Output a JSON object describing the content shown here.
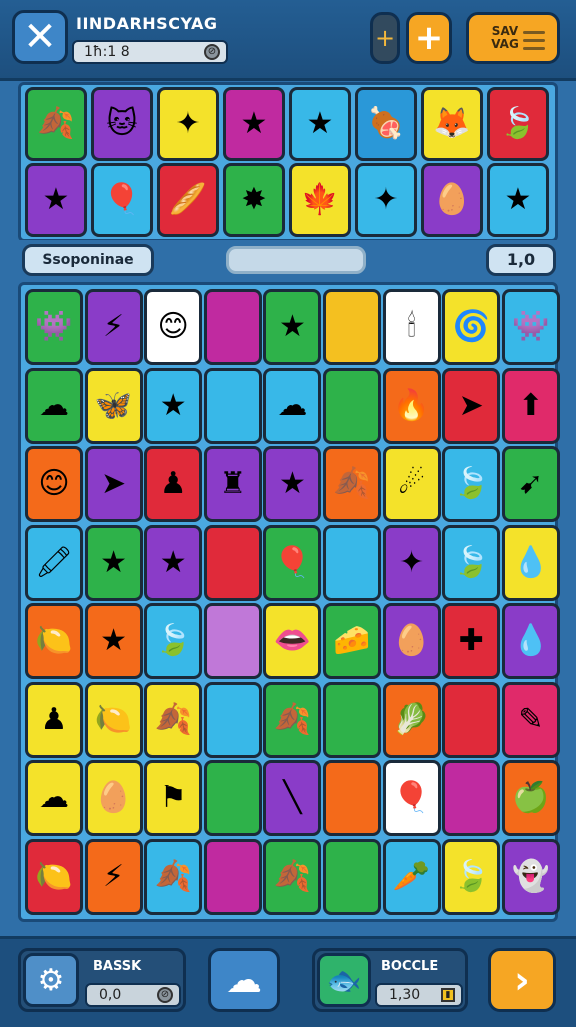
{
  "top_bar": {
    "close_glyph": "✕",
    "title": "IINDARHSCYAG",
    "counter": "1ħ:1 8",
    "counter_icon": "coin-icon",
    "toggle_glyph": "+",
    "plus_glyph": "+",
    "save_label": "SAV VAG"
  },
  "tray_tiles": [
    {
      "color": "#2eb24a",
      "glyph": "🍂",
      "icon": "leaf-icon"
    },
    {
      "color": "#8a3cc8",
      "glyph": "🐱",
      "icon": "cat-icon"
    },
    {
      "color": "#f4e22a",
      "glyph": "✦",
      "icon": "star-shard-icon"
    },
    {
      "color": "#c02aa0",
      "glyph": "★",
      "icon": "star-icon"
    },
    {
      "color": "#38b8e8",
      "glyph": "★",
      "icon": "star-icon"
    },
    {
      "color": "#2a98d8",
      "glyph": "🍖",
      "icon": "meat-icon"
    },
    {
      "color": "#f4e22a",
      "glyph": "🦊",
      "icon": "fox-icon"
    },
    {
      "color": "#e02a3a",
      "glyph": "🍃",
      "icon": "leaf-icon"
    },
    {
      "color": "#8a3cc8",
      "glyph": "★",
      "icon": "star-icon"
    },
    {
      "color": "#38b8e8",
      "glyph": "🎈",
      "icon": "balloon-icon"
    },
    {
      "color": "#e02a3a",
      "glyph": "🥖",
      "icon": "bread-icon"
    },
    {
      "color": "#2eb24a",
      "glyph": "✸",
      "icon": "splat-icon"
    },
    {
      "color": "#f4e22a",
      "glyph": "🍁",
      "icon": "leaf-icon"
    },
    {
      "color": "#38b8e8",
      "glyph": "✦",
      "icon": "star-icon"
    },
    {
      "color": "#8a3cc8",
      "glyph": "🥚",
      "icon": "egg-icon"
    },
    {
      "color": "#38b8e8",
      "glyph": "★",
      "icon": "star-icon"
    }
  ],
  "status_row": {
    "left_label": "Ssoponinae",
    "right_value": "1,0"
  },
  "board_rows": [
    [
      {
        "color": "#2eb24a",
        "glyph": "👾",
        "icon": "blob-icon"
      },
      {
        "color": "#8a3cc8",
        "glyph": "⚡",
        "icon": "bolt-icon"
      },
      {
        "color": "#ffffff",
        "glyph": "😊",
        "icon": "blob-icon"
      },
      {
        "color": "#c02aa0",
        "glyph": "",
        "icon": "empty-icon"
      },
      {
        "color": "#2eb24a",
        "glyph": "★",
        "icon": "star-icon"
      },
      {
        "color": "#f4c020",
        "glyph": "",
        "icon": "empty-icon"
      },
      {
        "color": "#ffffff",
        "glyph": "🕯",
        "icon": "candle-icon"
      },
      {
        "color": "#f4e22a",
        "glyph": "🌀",
        "icon": "swirl-icon"
      },
      {
        "color": "#38b8e8",
        "glyph": "👾",
        "icon": "blob-icon"
      }
    ],
    [
      {
        "color": "#2eb24a",
        "glyph": "☁",
        "icon": "cloud-icon"
      },
      {
        "color": "#f4e22a",
        "glyph": "🦋",
        "icon": "butterfly-icon"
      },
      {
        "color": "#38b8e8",
        "glyph": "★",
        "icon": "star-icon"
      },
      {
        "color": "#38b8e8",
        "glyph": "",
        "icon": "empty-icon"
      },
      {
        "color": "#38b8e8",
        "glyph": "☁",
        "icon": "cloud-icon"
      },
      {
        "color": "#2eb24a",
        "glyph": "",
        "icon": "empty-icon"
      },
      {
        "color": "#f46a1a",
        "glyph": "🔥",
        "icon": "flame-icon"
      },
      {
        "color": "#e02a3a",
        "glyph": "➤",
        "icon": "arrow-icon"
      },
      {
        "color": "#e02a6a",
        "glyph": "⬆",
        "icon": "up-arrow-icon"
      }
    ],
    [
      {
        "color": "#f46a1a",
        "glyph": "😊",
        "icon": "cookie-icon"
      },
      {
        "color": "#8a3cc8",
        "glyph": "➤",
        "icon": "arrow-icon"
      },
      {
        "color": "#e02a3a",
        "glyph": "♟",
        "icon": "pawn-icon"
      },
      {
        "color": "#8a3cc8",
        "glyph": "♜",
        "icon": "rook-icon"
      },
      {
        "color": "#8a3cc8",
        "glyph": "★",
        "icon": "star-icon"
      },
      {
        "color": "#f46a1a",
        "glyph": "🍂",
        "icon": "leaf-icon"
      },
      {
        "color": "#f4e22a",
        "glyph": "☄",
        "icon": "comet-icon"
      },
      {
        "color": "#38b8e8",
        "glyph": "🍃",
        "icon": "leaf-icon"
      },
      {
        "color": "#2eb24a",
        "glyph": "➹",
        "icon": "arrow-icon"
      }
    ],
    [
      {
        "color": "#38b8e8",
        "glyph": "🖍",
        "icon": "crayon-icon"
      },
      {
        "color": "#2eb24a",
        "glyph": "★",
        "icon": "star-icon"
      },
      {
        "color": "#8a3cc8",
        "glyph": "★",
        "icon": "star-icon"
      },
      {
        "color": "#e02a3a",
        "glyph": "",
        "icon": "empty-icon"
      },
      {
        "color": "#2eb24a",
        "glyph": "🎈",
        "icon": "balloon-icon"
      },
      {
        "color": "#38b8e8",
        "glyph": "",
        "icon": "empty-icon"
      },
      {
        "color": "#8a3cc8",
        "glyph": "✦",
        "icon": "star-icon"
      },
      {
        "color": "#38b8e8",
        "glyph": "🍃",
        "icon": "leaf-icon"
      },
      {
        "color": "#f4e22a",
        "glyph": "💧",
        "icon": "drop-icon"
      }
    ],
    [
      {
        "color": "#f46a1a",
        "glyph": "🍋",
        "icon": "lemon-icon"
      },
      {
        "color": "#f46a1a",
        "glyph": "★",
        "icon": "star-icon"
      },
      {
        "color": "#38b8e8",
        "glyph": "🍃",
        "icon": "leaf-icon"
      },
      {
        "color": "#c078d8",
        "glyph": "",
        "icon": "empty-icon"
      },
      {
        "color": "#f4e22a",
        "glyph": "👄",
        "icon": "lips-icon"
      },
      {
        "color": "#2eb24a",
        "glyph": "🧀",
        "icon": "cheese-icon"
      },
      {
        "color": "#8a3cc8",
        "glyph": "🥚",
        "icon": "egg-icon"
      },
      {
        "color": "#e02a3a",
        "glyph": "✚",
        "icon": "puzzle-icon"
      },
      {
        "color": "#8a3cc8",
        "glyph": "💧",
        "icon": "drop-icon"
      }
    ],
    [
      {
        "color": "#f4e22a",
        "glyph": "♟",
        "icon": "pawn-icon"
      },
      {
        "color": "#f4e22a",
        "glyph": "🍋",
        "icon": "lemon-icon"
      },
      {
        "color": "#f4e22a",
        "glyph": "🍂",
        "icon": "leaf-icon"
      },
      {
        "color": "#38b8e8",
        "glyph": "",
        "icon": "empty-icon"
      },
      {
        "color": "#2eb24a",
        "glyph": "🍂",
        "icon": "leaf-icon"
      },
      {
        "color": "#2eb24a",
        "glyph": "",
        "icon": "empty-icon"
      },
      {
        "color": "#f46a1a",
        "glyph": "🥬",
        "icon": "lettuce-icon"
      },
      {
        "color": "#e02a3a",
        "glyph": "",
        "icon": "empty-icon"
      },
      {
        "color": "#e02a6a",
        "glyph": "✎",
        "icon": "pencil-icon"
      }
    ],
    [
      {
        "color": "#f4e22a",
        "glyph": "☁",
        "icon": "cloud-icon"
      },
      {
        "color": "#f4e22a",
        "glyph": "🥚",
        "icon": "egg-icon"
      },
      {
        "color": "#f4e22a",
        "glyph": "⚑",
        "icon": "flag-icon"
      },
      {
        "color": "#2eb24a",
        "glyph": "",
        "icon": "empty-icon"
      },
      {
        "color": "#8a3cc8",
        "glyph": "╲",
        "icon": "stick-icon"
      },
      {
        "color": "#f46a1a",
        "glyph": "",
        "icon": "empty-icon"
      },
      {
        "color": "#ffffff",
        "glyph": "🎈",
        "icon": "balloon-icon"
      },
      {
        "color": "#c02aa0",
        "glyph": "",
        "icon": "empty-icon"
      },
      {
        "color": "#f46a1a",
        "glyph": "🍏",
        "icon": "apple-icon"
      }
    ],
    [
      {
        "color": "#e02a3a",
        "glyph": "🍋",
        "icon": "lemon-icon"
      },
      {
        "color": "#f46a1a",
        "glyph": "⚡",
        "icon": "bolt-icon"
      },
      {
        "color": "#38b8e8",
        "glyph": "🍂",
        "icon": "leaf-icon"
      },
      {
        "color": "#c02aa0",
        "glyph": "",
        "icon": "empty-icon"
      },
      {
        "color": "#2eb24a",
        "glyph": "🍂",
        "icon": "leaf-icon"
      },
      {
        "color": "#2eb24a",
        "glyph": "",
        "icon": "empty-icon"
      },
      {
        "color": "#38b8e8",
        "glyph": "🥕",
        "icon": "carrot-icon"
      },
      {
        "color": "#f4e22a",
        "glyph": "🍃",
        "icon": "leaf-icon"
      },
      {
        "color": "#8a3cc8",
        "glyph": "👻",
        "icon": "ghost-icon"
      }
    ]
  ],
  "bottom_bar": {
    "left_icon_glyph": "⚙",
    "left_label": "BASSK",
    "left_value": "0,0",
    "cloud_glyph": "☁",
    "right_icon_glyph": "🐟",
    "right_label": "BOCCLE",
    "right_value": "1,30",
    "next_glyph": "›"
  }
}
